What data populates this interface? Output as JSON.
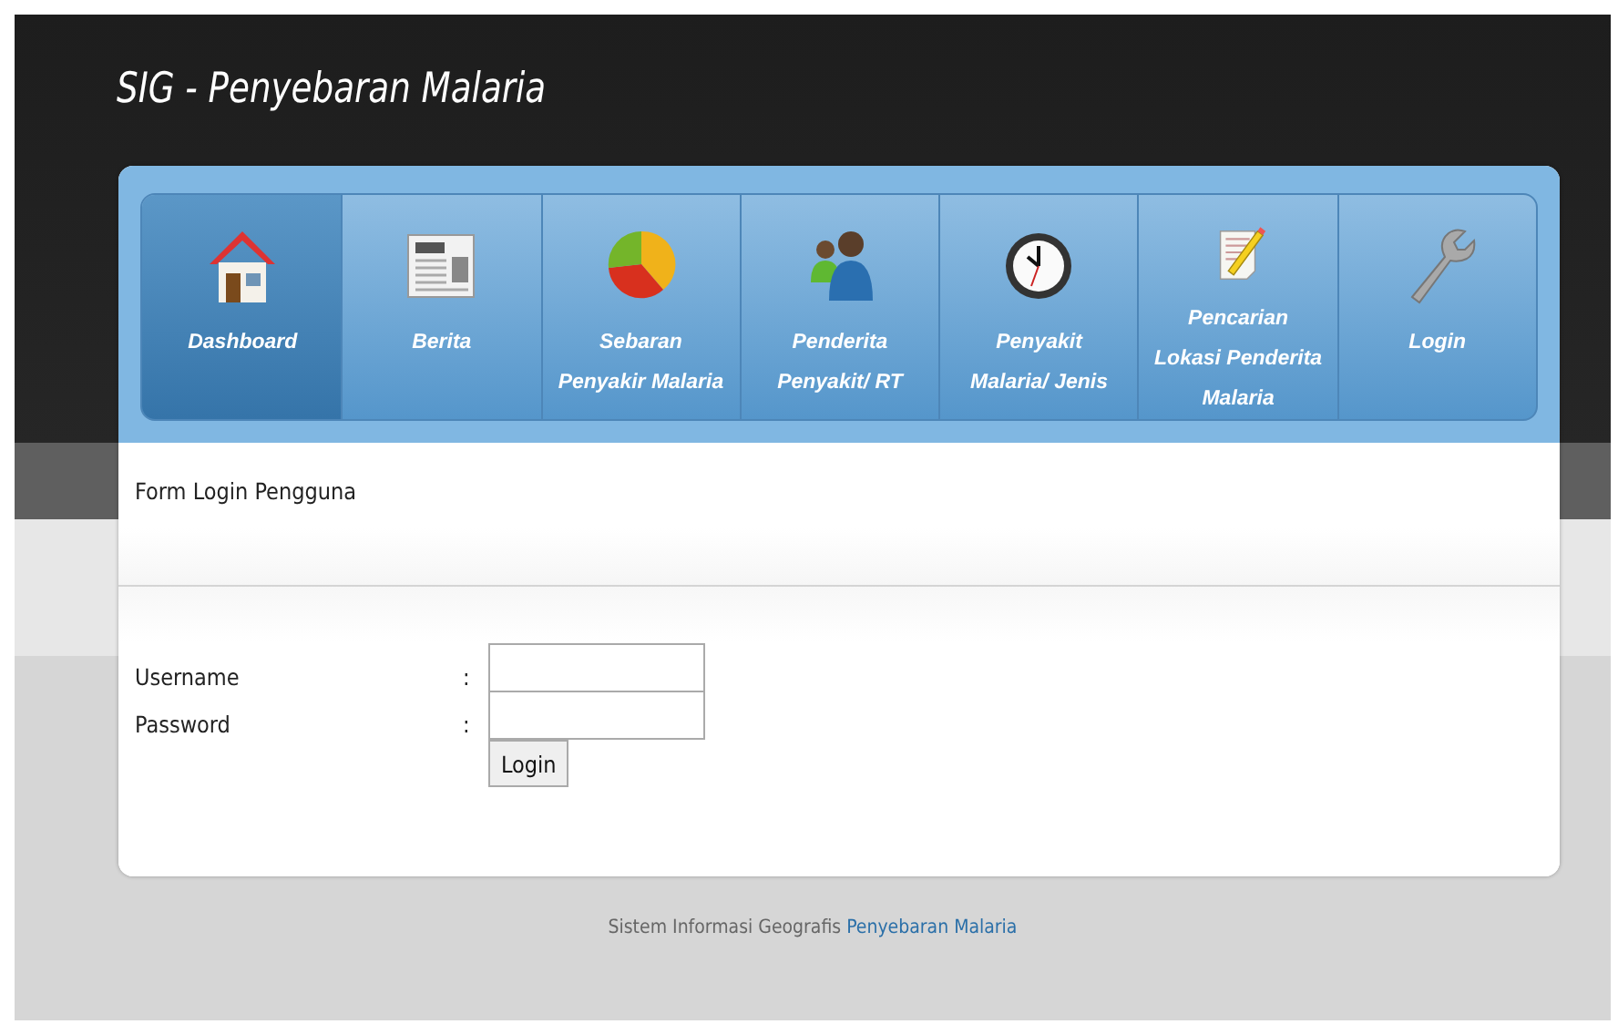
{
  "site_title": "SIG - Penyebaran Malaria",
  "nav": [
    {
      "label": "Dashboard",
      "selected": true
    },
    {
      "label": "Berita",
      "selected": false
    },
    {
      "label": "Sebaran Penyakir Malaria",
      "selected": false
    },
    {
      "label": "Penderita Penyakit/ RT",
      "selected": false
    },
    {
      "label": "Penyakit Malaria/ Jenis",
      "selected": false
    },
    {
      "label": "Pencarian Lokasi Penderita Malaria",
      "selected": false
    },
    {
      "label": "Login",
      "selected": false
    }
  ],
  "form": {
    "title": "Form Login Pengguna",
    "fields": [
      {
        "label": "Username",
        "separator": ":"
      },
      {
        "label": "Password",
        "separator": ":"
      }
    ],
    "submit": "Login"
  },
  "footer": {
    "text": "Sistem Informasi Geografis",
    "link": "Penyebaran Malaria"
  }
}
